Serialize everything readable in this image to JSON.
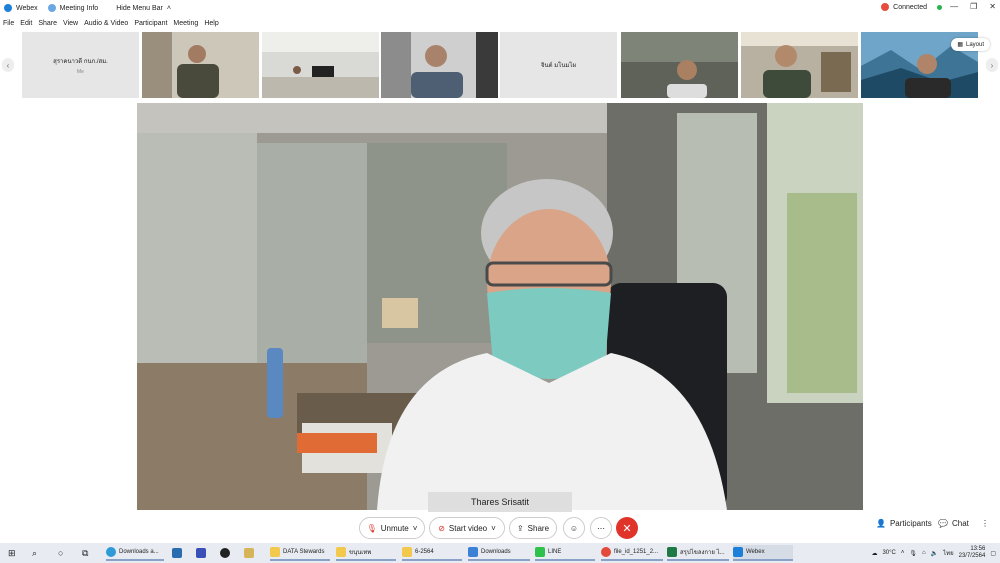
{
  "titlebar": {
    "app_name": "Webex",
    "meeting_info": "Meeting Info",
    "hide_menu_bar": "Hide Menu Bar",
    "status": "Connected"
  },
  "menu": [
    "File",
    "Edit",
    "Share",
    "View",
    "Audio & Video",
    "Participant",
    "Meeting",
    "Help"
  ],
  "participants": [
    {
      "name": "สุราคนาวดี กนก./สม.",
      "sub": "Me"
    },
    {
      "name": "จินต์ มโนมไผ",
      "sub": ""
    }
  ],
  "layout_label": "Layout",
  "active_speaker": "Thares Srisatit",
  "controls": {
    "unmute": "Unmute",
    "start_video": "Start video",
    "share": "Share",
    "participants": "Participants",
    "chat": "Chat"
  },
  "taskbar": {
    "items": [
      "Downloads a...",
      "DATA Stewards",
      "ขนุนเทพ",
      "6-2564",
      "Downloads",
      "LINE",
      "file_id_1251_2...",
      "สรุปไขลงกาย ไ...",
      "Webex"
    ],
    "weather": "30°C",
    "lang": "ไทย",
    "time": "13:56",
    "date": "23/7/2564"
  },
  "colors": {
    "accent": "#1d7fd8",
    "end_call": "#e0332a",
    "connected": "#2bb24c"
  }
}
